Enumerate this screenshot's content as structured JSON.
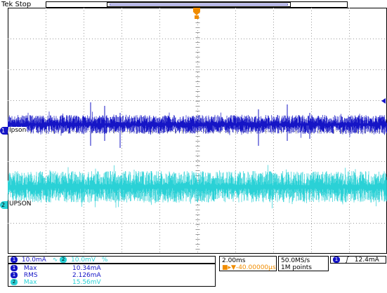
{
  "header": {
    "status": "Tek Stop"
  },
  "channels": [
    {
      "id": "1",
      "label": "Ipson",
      "color": "#1515c6"
    },
    {
      "id": "2",
      "label": "UPSON",
      "color": "#2ad1d6"
    }
  ],
  "vertical": {
    "ch1_scale": "10.0mA",
    "ch2_scale": "10.0mV",
    "ch2_bw_symbol": "%"
  },
  "measurements": [
    {
      "channel": "1",
      "name": "Max",
      "value": "10.34mA"
    },
    {
      "channel": "1",
      "name": "RMS",
      "value": "2.126mA"
    },
    {
      "channel": "2",
      "name": "Max",
      "value": "15.56mV"
    }
  ],
  "timebase": {
    "scale": "2.00ms",
    "delay": "-40.00000µs",
    "sample_rate": "50.0MS/s",
    "record_length": "1M points"
  },
  "trigger": {
    "channel": "1",
    "slope_symbol": "ʃ",
    "level": "12.4mA"
  },
  "colors": {
    "ch1": "#1515c6",
    "ch2": "#2ad1d6",
    "trigger_marker": "#f08c00",
    "grid": "#9a9a9a"
  }
}
